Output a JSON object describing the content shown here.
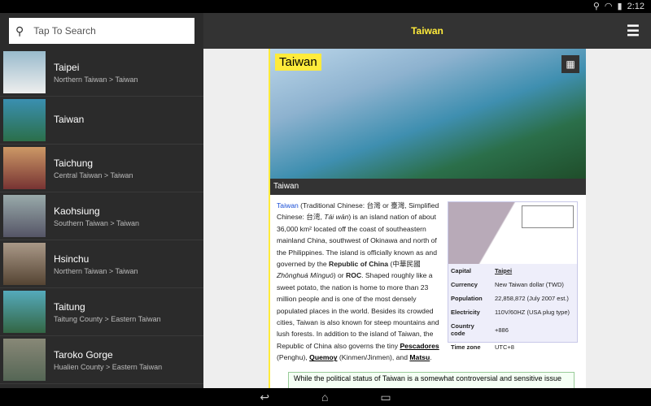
{
  "status": {
    "time": "2:12"
  },
  "search": {
    "placeholder": "Tap To Search"
  },
  "header": {
    "title": "Taiwan"
  },
  "list": [
    {
      "title": "Taipei",
      "subtitle": "Northern Taiwan > Taiwan"
    },
    {
      "title": "Taiwan",
      "subtitle": ""
    },
    {
      "title": "Taichung",
      "subtitle": "Central Taiwan > Taiwan"
    },
    {
      "title": "Kaohsiung",
      "subtitle": "Southern Taiwan > Taiwan"
    },
    {
      "title": "Hsinchu",
      "subtitle": "Northern Taiwan > Taiwan"
    },
    {
      "title": "Taitung",
      "subtitle": "Taitung County > Eastern Taiwan"
    },
    {
      "title": "Taroko Gorge",
      "subtitle": "Hualien County > Eastern Taiwan"
    }
  ],
  "article": {
    "hero_title": "Taiwan",
    "caption": "Taiwan",
    "link": "Taiwan",
    "p1": " (Traditional Chinese: 台灣 or 臺灣, Simplified Chinese: 台湾, ",
    "p1i": "Tái wān",
    "p2": ") is an island nation of about 36,000 km² located off the coast of southeastern mainland China, southwest of Okinawa and north of the Philippines. The island is officially known as and governed by the ",
    "b1": "Republic of China",
    "p3": " (中華民國 ",
    "p3i": "Zhōnghuá Mínguó",
    "p4": ") or ",
    "b2": "ROC",
    "p5": ". Shaped roughly like a sweet potato, the nation is home to more than 23 million people and is one of the most densely populated places in the world. Besides its crowded cities, Taiwan is also known for steep mountains and lush forests. In addition to the island of Taiwan, the Republic of China also governs the tiny ",
    "l1": "Pescadores",
    "p6": " (Penghu), ",
    "l2": "Quemoy",
    "p7": " (Kinmen/Jinmen), and ",
    "l3": "Matsu",
    "p8": ".",
    "note": "While the political status of Taiwan is a somewhat controversial and sensitive issue"
  },
  "infobox": [
    {
      "k": "Capital",
      "v": "Taipei"
    },
    {
      "k": "Currency",
      "v": "New Taiwan dollar (TWD)"
    },
    {
      "k": "Population",
      "v": "22,858,872 (July 2007 est.)"
    },
    {
      "k": "Electricity",
      "v": "110V/60HZ (USA plug type)"
    },
    {
      "k": "Country code",
      "v": "+886"
    },
    {
      "k": "Time zone",
      "v": "UTC+8"
    }
  ]
}
